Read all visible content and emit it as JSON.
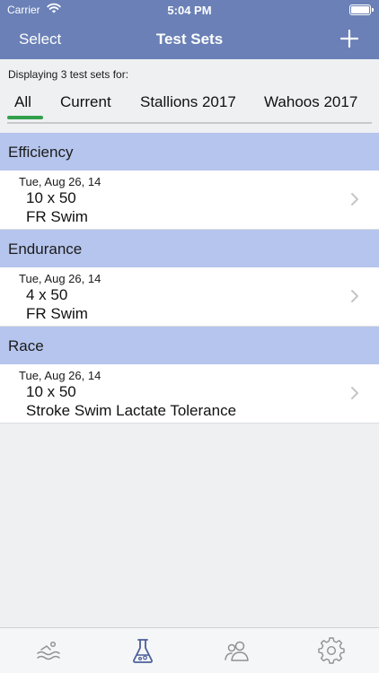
{
  "status": {
    "carrier": "Carrier",
    "time": "5:04 PM"
  },
  "nav": {
    "left": "Select",
    "title": "Test Sets",
    "add_icon": "plus-icon"
  },
  "filter": {
    "caption": "Displaying 3 test sets for:",
    "tabs": [
      "All",
      "Current",
      "Stallions 2017",
      "Wahoos 2017"
    ],
    "selected": "All",
    "accent": "#33a04c"
  },
  "sections": [
    {
      "header": "Efficiency",
      "items": [
        {
          "date": "Tue, Aug 26, 14",
          "line1": "10 x 50",
          "line2": "FR Swim"
        }
      ]
    },
    {
      "header": "Endurance",
      "items": [
        {
          "date": "Tue, Aug 26, 14",
          "line1": "4 x 50",
          "line2": "FR Swim"
        }
      ]
    },
    {
      "header": "Race",
      "items": [
        {
          "date": "Tue, Aug 26, 14",
          "line1": "10 x 50",
          "line2": "Stroke Swim Lactate Tolerance"
        }
      ]
    }
  ],
  "tabbar": {
    "icons": [
      "swim-icon",
      "flask-icon",
      "people-icon",
      "gear-icon"
    ],
    "active": "flask-icon"
  },
  "colors": {
    "nav_bar": "#6a80b6",
    "section_header": "#b6c5ed",
    "active_tab_icon": "#4a5f9a",
    "inactive_tab_icon": "#8e9196"
  }
}
